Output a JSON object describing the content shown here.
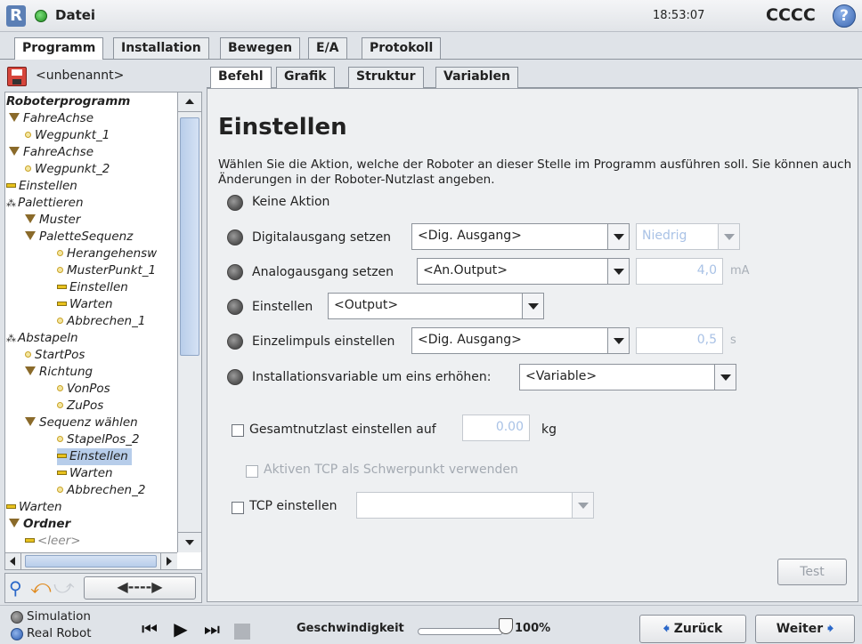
{
  "header": {
    "menu_label": "Datei",
    "time": "18:53:07",
    "robot_name": "CCCC"
  },
  "main_tabs": [
    "Programm",
    "Installation",
    "Bewegen",
    "E/A",
    "Protokoll"
  ],
  "program_name": "<unbenannt>",
  "sub_tabs": [
    "Befehl",
    "Grafik",
    "Struktur",
    "Variablen"
  ],
  "tree": [
    {
      "label": "Roboterprogramm",
      "bold": true
    },
    {
      "label": "FahreAchse"
    },
    {
      "label": "Wegpunkt_1"
    },
    {
      "label": "FahreAchse"
    },
    {
      "label": "Wegpunkt_2"
    },
    {
      "label": "Einstellen"
    },
    {
      "label": "Palettieren"
    },
    {
      "label": "Muster"
    },
    {
      "label": "PaletteSequenz"
    },
    {
      "label": "Herangehensw"
    },
    {
      "label": "MusterPunkt_1"
    },
    {
      "label": "Einstellen"
    },
    {
      "label": "Warten"
    },
    {
      "label": "Abbrechen_1"
    },
    {
      "label": "Abstapeln"
    },
    {
      "label": "StartPos"
    },
    {
      "label": "Richtung"
    },
    {
      "label": "VonPos"
    },
    {
      "label": "ZuPos"
    },
    {
      "label": "Sequenz wählen"
    },
    {
      "label": "StapelPos_2"
    },
    {
      "label": "Einstellen",
      "selected": true
    },
    {
      "label": "Warten"
    },
    {
      "label": "Abbrechen_2"
    },
    {
      "label": "Warten"
    },
    {
      "label": "Ordner",
      "bold": true
    },
    {
      "label": "<leer>"
    }
  ],
  "content": {
    "title": "Einstellen",
    "description": "Wählen Sie die Aktion, welche der Roboter an dieser Stelle im Programm ausführen soll. Sie können auch Änderungen in der Roboter-Nutzlast angeben.",
    "opt_none": "Keine Aktion",
    "opt_digital": "Digitalausgang setzen",
    "digital_combo": "<Dig. Ausgang>",
    "digital_level": "Niedrig",
    "opt_analog": "Analogausgang setzen",
    "analog_combo": "<An.Output>",
    "analog_value": "4,0",
    "analog_unit": "mA",
    "opt_set": "Einstellen",
    "set_combo": "<Output>",
    "opt_pulse": "Einzelimpuls einstellen",
    "pulse_combo": "<Dig. Ausgang>",
    "pulse_value": "0,5",
    "pulse_unit": "s",
    "opt_install": "Installationsvariable um eins erhöhen:",
    "install_combo": "<Variable>",
    "payload_label": "Gesamtnutzlast einstellen auf",
    "payload_value": "0.00",
    "payload_unit": "kg",
    "tcp_cog_label": "Aktiven TCP als Schwerpunkt verwenden",
    "tcp_label": "TCP einstellen",
    "test_button": "Test"
  },
  "footer": {
    "simulation": "Simulation",
    "real_robot": "Real Robot",
    "speed_label": "Geschwindigkeit",
    "speed_value": "100%",
    "back": "Zurück",
    "next": "Weiter"
  }
}
